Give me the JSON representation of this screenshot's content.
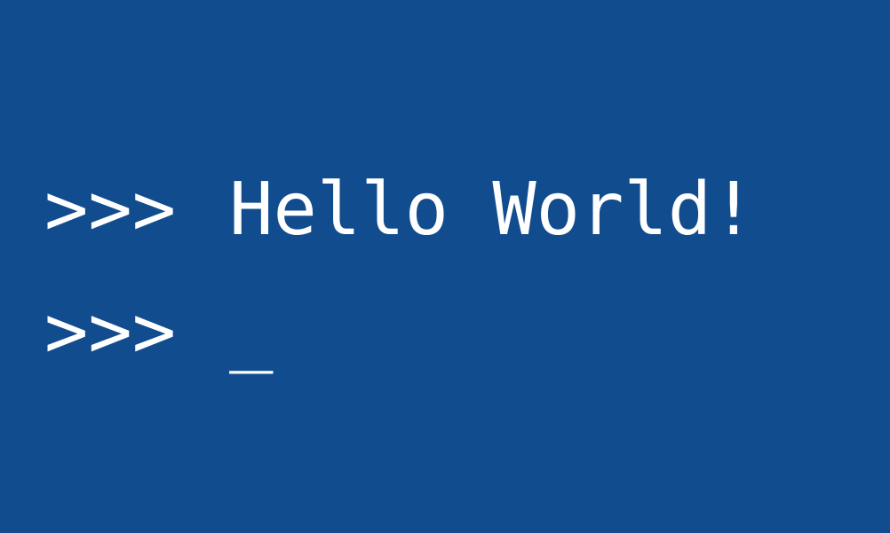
{
  "console": {
    "background_color": "#114c8e",
    "text_color": "#ffffff",
    "lines": [
      {
        "prompt": ">>>",
        "text": "Hello World!"
      },
      {
        "prompt": ">>>",
        "text": "_"
      }
    ]
  }
}
